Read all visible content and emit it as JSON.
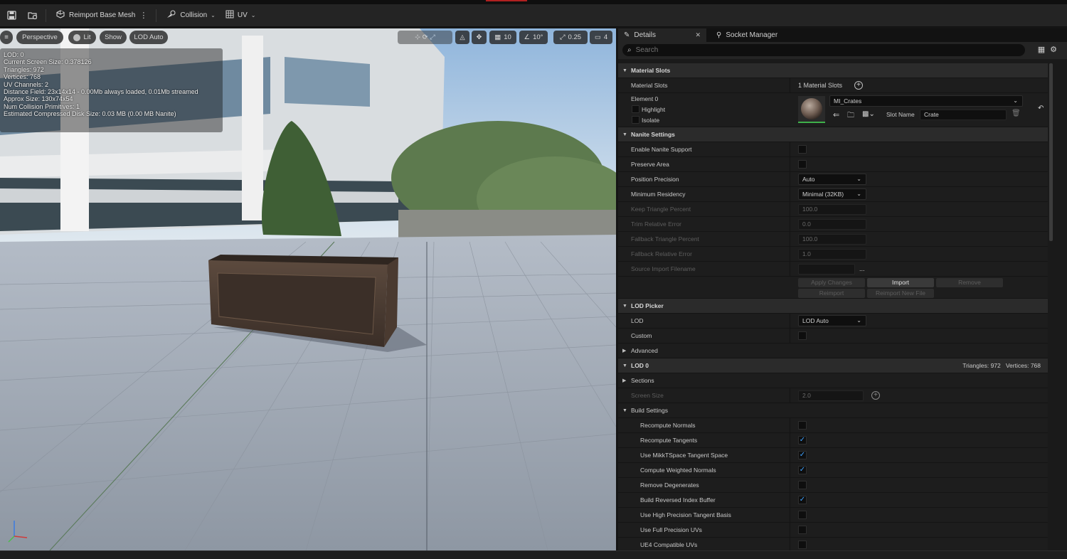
{
  "toolbar": {
    "reimport_label": "Reimport Base Mesh",
    "collision_label": "Collision",
    "uv_label": "UV"
  },
  "viewport": {
    "perspective": "Perspective",
    "lit": "Lit",
    "show": "Show",
    "lod": "LOD Auto",
    "grid_snap": "10",
    "rot_snap": "10°",
    "scale_snap": "0.25",
    "camera_speed": "4",
    "stats": [
      "LOD: 0",
      "Current Screen Size: 0.378126",
      "Triangles: 972",
      "Vertices: 768",
      "UV Channels: 2",
      "Distance Field: 23x14x14 - 0.00Mb always loaded, 0.01Mb streamed",
      "Approx Size: 130x74x54",
      "Num Collision Primitives: 1",
      "Estimated Compressed Disk Size: 0.03 MB (0.00 MB Nanite)"
    ]
  },
  "panel": {
    "tab_details": "Details",
    "tab_socket": "Socket Manager",
    "search_placeholder": "Search",
    "material_slots": {
      "header": "Material Slots",
      "label": "Material Slots",
      "count": "1 Material Slots",
      "element": "Element 0",
      "highlight": "Highlight",
      "isolate": "Isolate",
      "material": "MI_Crates",
      "slot_name_label": "Slot Name",
      "slot_name": "Crate"
    },
    "nanite": {
      "header": "Nanite Settings",
      "enable": "Enable Nanite Support",
      "preserve": "Preserve Area",
      "position_precision": "Position Precision",
      "position_precision_val": "Auto",
      "min_residency": "Minimum Residency",
      "min_residency_val": "Minimal (32KB)",
      "keep_triangle": "Keep Triangle Percent",
      "keep_triangle_val": "100.0",
      "trim_error": "Trim Relative Error",
      "trim_error_val": "0.0",
      "fallback_tri": "Fallback Triangle Percent",
      "fallback_tri_val": "100.0",
      "fallback_err": "Fallback Relative Error",
      "fallback_err_val": "1.0",
      "source_import": "Source Import Filename",
      "apply": "Apply Changes",
      "import": "Import",
      "remove": "Remove",
      "reimport": "Reimport",
      "reimport_new": "Reimport New File"
    },
    "lod_picker": {
      "header": "LOD Picker",
      "lod": "LOD",
      "lod_val": "LOD Auto",
      "custom": "Custom",
      "advanced": "Advanced"
    },
    "lod0": {
      "header": "LOD 0",
      "triangles": "Triangles: 972",
      "vertices": "Vertices: 768",
      "sections": "Sections",
      "screen_size": "Screen Size",
      "screen_size_val": "2.0"
    },
    "build": {
      "header": "Build Settings",
      "items": [
        {
          "label": "Recompute Normals",
          "checked": false
        },
        {
          "label": "Recompute Tangents",
          "checked": true
        },
        {
          "label": "Use MikkTSpace Tangent Space",
          "checked": true
        },
        {
          "label": "Compute Weighted Normals",
          "checked": true
        },
        {
          "label": "Remove Degenerates",
          "checked": false
        },
        {
          "label": "Build Reversed Index Buffer",
          "checked": true
        },
        {
          "label": "Use High Precision Tangent Basis",
          "checked": false
        },
        {
          "label": "Use Full Precision UVs",
          "checked": false
        },
        {
          "label": "UE4 Compatible UVs",
          "checked": false
        }
      ]
    }
  }
}
